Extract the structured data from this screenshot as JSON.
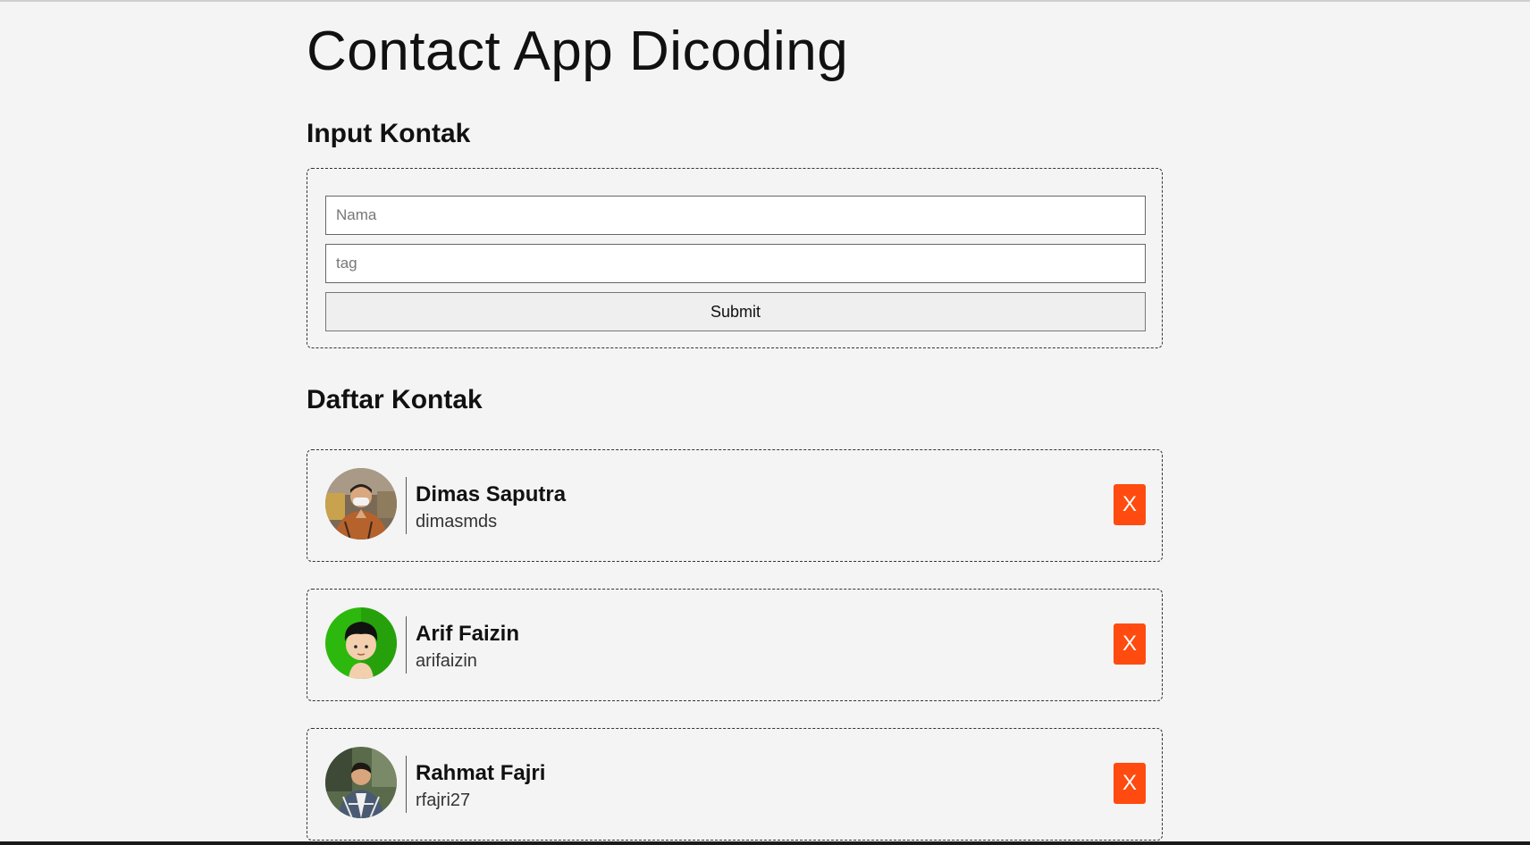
{
  "app": {
    "title": "Contact App Dicoding"
  },
  "form": {
    "heading": "Input Kontak",
    "name_placeholder": "Nama",
    "name_value": "",
    "tag_placeholder": "tag",
    "tag_value": "",
    "submit_label": "Submit"
  },
  "list": {
    "heading": "Daftar Kontak",
    "contacts": [
      {
        "name": "Dimas Saputra",
        "tag": "dimasmds",
        "delete_label": "X"
      },
      {
        "name": "Arif Faizin",
        "tag": "arifaizin",
        "delete_label": "X"
      },
      {
        "name": "Rahmat Fajri",
        "tag": "rfajri27",
        "delete_label": "X"
      }
    ]
  },
  "colors": {
    "background": "#f4f4f4",
    "delete_button": "#ff4b0f",
    "avatar_green": "#2db80d"
  }
}
